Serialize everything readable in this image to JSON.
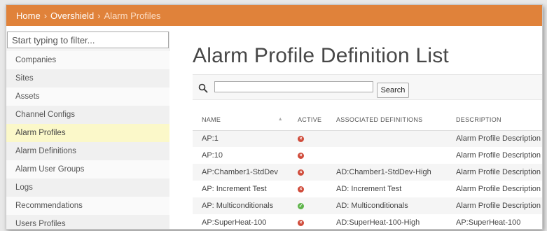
{
  "breadcrumb": {
    "home": "Home",
    "site": "Overshield",
    "current": "Alarm Profiles",
    "separator": "›"
  },
  "sidebar": {
    "filter_placeholder": "Start typing to filter...",
    "items": [
      {
        "label": "Companies",
        "active": false
      },
      {
        "label": "Sites",
        "active": false
      },
      {
        "label": "Assets",
        "active": false
      },
      {
        "label": "Channel Configs",
        "active": false
      },
      {
        "label": "Alarm Profiles",
        "active": true
      },
      {
        "label": "Alarm Definitions",
        "active": false
      },
      {
        "label": "Alarm User Groups",
        "active": false
      },
      {
        "label": "Logs",
        "active": false
      },
      {
        "label": "Recommendations",
        "active": false
      },
      {
        "label": "Users Profiles",
        "active": false
      }
    ]
  },
  "main": {
    "title": "Alarm Profile Definition List",
    "search": {
      "value": "",
      "button_label": "Search"
    },
    "table": {
      "columns": [
        "NAME",
        "ACTIVE",
        "ASSOCIATED DEFINITIONS",
        "DESCRIPTION"
      ],
      "rows": [
        {
          "name": "AP:1",
          "active": false,
          "definitions": "",
          "description": "Alarm Profile Description"
        },
        {
          "name": "AP:10",
          "active": false,
          "definitions": "",
          "description": "Alarm Profile Description"
        },
        {
          "name": "AP:Chamber1-StdDev",
          "active": false,
          "definitions": "AD:Chamber1-StdDev-High",
          "description": "Alarm Profile Description"
        },
        {
          "name": "AP: Increment Test",
          "active": false,
          "definitions": "AD: Increment Test",
          "description": "Alarm Profile Description"
        },
        {
          "name": "AP: Multiconditionals",
          "active": true,
          "definitions": "AD: Multiconditionals",
          "description": "Alarm Profile Description"
        },
        {
          "name": "AP:SuperHeat-100",
          "active": false,
          "definitions": "AD:SuperHeat-100-High",
          "description": "AP:SuperHeat-100"
        }
      ]
    }
  },
  "colors": {
    "header_bg": "#e0823a",
    "active_nav_bg": "#fbf8c9",
    "status_active": "#5eb44a",
    "status_inactive": "#d04b3a"
  },
  "icons": {
    "search": "search-icon",
    "sort": "sort-ascending-icon",
    "active": "check-circle-icon",
    "inactive": "x-circle-icon"
  }
}
